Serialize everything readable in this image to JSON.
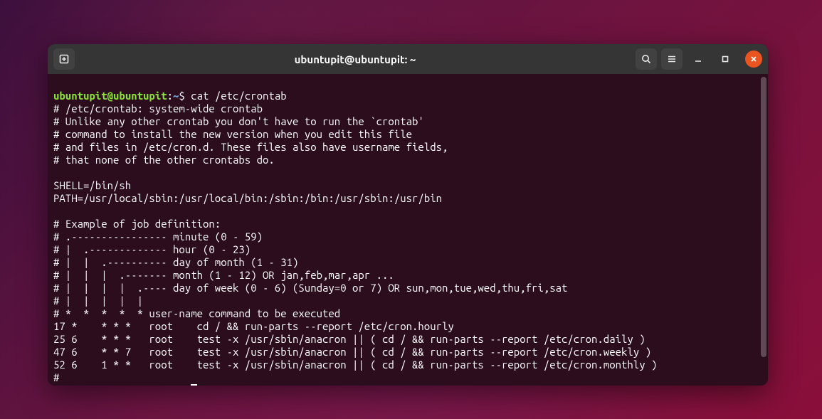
{
  "window": {
    "title": "ubuntupit@ubuntupit: ~"
  },
  "prompt": {
    "user": "ubuntupit",
    "host": "ubuntupit",
    "path": "~",
    "symbol": "$"
  },
  "command1": "cat /etc/crontab",
  "output": {
    "l01": "# /etc/crontab: system-wide crontab",
    "l02": "# Unlike any other crontab you don't have to run the `crontab'",
    "l03": "# command to install the new version when you edit this file",
    "l04": "# and files in /etc/cron.d. These files also have username fields,",
    "l05": "# that none of the other crontabs do.",
    "l06": "",
    "l07": "SHELL=/bin/sh",
    "l08": "PATH=/usr/local/sbin:/usr/local/bin:/sbin:/bin:/usr/sbin:/usr/bin",
    "l09": "",
    "l10": "# Example of job definition:",
    "l11": "# .---------------- minute (0 - 59)",
    "l12": "# |  .------------- hour (0 - 23)",
    "l13": "# |  |  .---------- day of month (1 - 31)",
    "l14": "# |  |  |  .------- month (1 - 12) OR jan,feb,mar,apr ...",
    "l15": "# |  |  |  |  .---- day of week (0 - 6) (Sunday=0 or 7) OR sun,mon,tue,wed,thu,fri,sat",
    "l16": "# |  |  |  |  |",
    "l17": "# *  *  *  *  * user-name command to be executed",
    "l18": "17 *    * * *   root    cd / && run-parts --report /etc/cron.hourly",
    "l19": "25 6    * * *   root    test -x /usr/sbin/anacron || ( cd / && run-parts --report /etc/cron.daily )",
    "l20": "47 6    * * 7   root    test -x /usr/sbin/anacron || ( cd / && run-parts --report /etc/cron.weekly )",
    "l21": "52 6    1 * *   root    test -x /usr/sbin/anacron || ( cd / && run-parts --report /etc/cron.monthly )",
    "l22": "#"
  },
  "icons": {
    "new_tab": "new-tab-icon",
    "search": "search-icon",
    "menu": "hamburger-menu-icon",
    "minimize": "minimize-icon",
    "maximize": "maximize-icon",
    "close": "close-icon"
  }
}
